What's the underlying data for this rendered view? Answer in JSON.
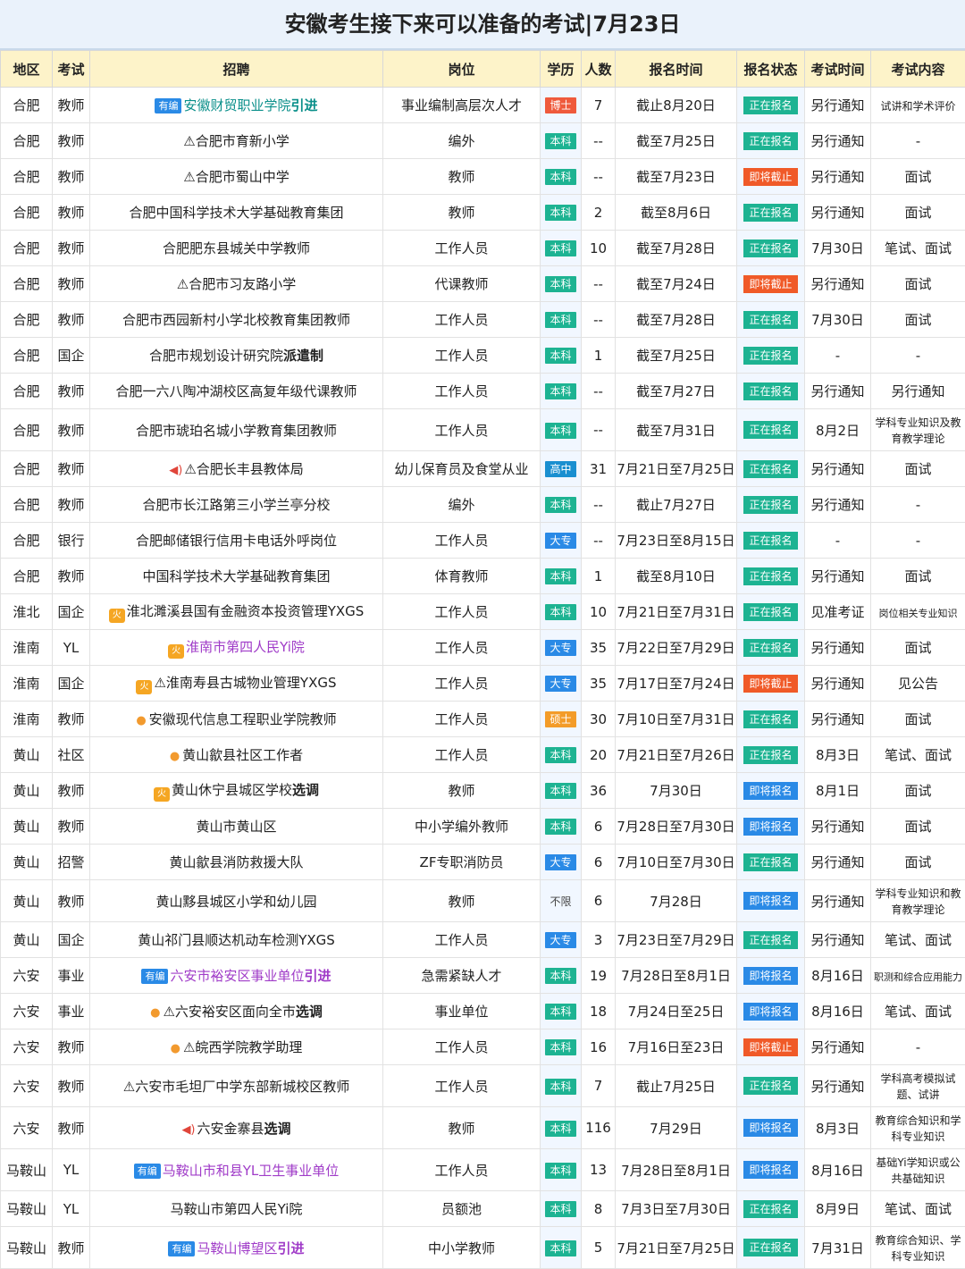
{
  "title": "安徽考生接下来可以准备的考试|7月23日",
  "headers": [
    "地区",
    "考试",
    "招聘",
    "岗位",
    "学历",
    "人数",
    "报名时间",
    "报名状态",
    "考试时间",
    "考试内容"
  ],
  "rows": [
    {
      "region": "合肥",
      "type": "教师",
      "pre": "tag",
      "tag": "有编",
      "name": "安徽财贸职业学院",
      "bold": "引进",
      "color": "teal",
      "post": "事业编制高层次人才",
      "edu": "博士",
      "eclass": "b-bs",
      "num": "7",
      "reg": "截止8月20日",
      "status": "正在报名",
      "sclass": "s-open",
      "exam": "另行通知",
      "content": "试讲和学术评价",
      "cclass": "sm"
    },
    {
      "region": "合肥",
      "type": "教师",
      "name": "⚠合肥市育新小学",
      "post": "编外",
      "edu": "本科",
      "eclass": "b-bk",
      "num": "--",
      "reg": "截至7月25日",
      "status": "正在报名",
      "sclass": "s-open",
      "exam": "另行通知",
      "content": "-"
    },
    {
      "region": "合肥",
      "type": "教师",
      "name": "⚠合肥市蜀山中学",
      "post": "教师",
      "edu": "本科",
      "eclass": "b-bk",
      "num": "--",
      "reg": "截至7月23日",
      "status": "即将截止",
      "sclass": "s-close",
      "exam": "另行通知",
      "content": "面试"
    },
    {
      "region": "合肥",
      "type": "教师",
      "name": "合肥中国科学技术大学基础教育集团",
      "post": "教师",
      "edu": "本科",
      "eclass": "b-bk",
      "num": "2",
      "reg": "截至8月6日",
      "status": "正在报名",
      "sclass": "s-open",
      "exam": "另行通知",
      "content": "面试"
    },
    {
      "region": "合肥",
      "type": "教师",
      "name": "合肥肥东县城关中学教师",
      "post": "工作人员",
      "edu": "本科",
      "eclass": "b-bk",
      "num": "10",
      "reg": "截至7月28日",
      "status": "正在报名",
      "sclass": "s-open",
      "exam": "7月30日",
      "content": "笔试、面试"
    },
    {
      "region": "合肥",
      "type": "教师",
      "name": "⚠合肥市习友路小学",
      "post": "代课教师",
      "edu": "本科",
      "eclass": "b-bk",
      "num": "--",
      "reg": "截至7月24日",
      "status": "即将截止",
      "sclass": "s-close",
      "exam": "另行通知",
      "content": "面试"
    },
    {
      "region": "合肥",
      "type": "教师",
      "name": "合肥市西园新村小学北校教育集团教师",
      "post": "工作人员",
      "edu": "本科",
      "eclass": "b-bk",
      "num": "--",
      "reg": "截至7月28日",
      "status": "正在报名",
      "sclass": "s-open",
      "exam": "7月30日",
      "content": "面试"
    },
    {
      "region": "合肥",
      "type": "国企",
      "name": "合肥市规划设计研究院",
      "bold": "派遣制",
      "post": "工作人员",
      "edu": "本科",
      "eclass": "b-bk",
      "num": "1",
      "reg": "截至7月25日",
      "status": "正在报名",
      "sclass": "s-open",
      "exam": "-",
      "content": "-"
    },
    {
      "region": "合肥",
      "type": "教师",
      "name": "合肥一六八陶冲湖校区高复年级代课教师",
      "post": "工作人员",
      "edu": "本科",
      "eclass": "b-bk",
      "num": "--",
      "reg": "截至7月27日",
      "status": "正在报名",
      "sclass": "s-open",
      "exam": "另行通知",
      "content": "另行通知"
    },
    {
      "region": "合肥",
      "type": "教师",
      "name": "合肥市琥珀名城小学教育集团教师",
      "post": "工作人员",
      "edu": "本科",
      "eclass": "b-bk",
      "num": "--",
      "reg": "截至7月31日",
      "status": "正在报名",
      "sclass": "s-open",
      "exam": "8月2日",
      "content": "学科专业知识及教育教学理论",
      "cclass": "sm",
      "tall": true
    },
    {
      "region": "合肥",
      "type": "教师",
      "pre": "mega",
      "name": "⚠合肥长丰县教体局",
      "post": "幼儿保育员及食堂从业",
      "edu": "高中",
      "eclass": "b-gz",
      "num": "31",
      "reg": "7月21日至7月25日",
      "status": "正在报名",
      "sclass": "s-open",
      "exam": "另行通知",
      "content": "面试"
    },
    {
      "region": "合肥",
      "type": "教师",
      "name": "合肥市长江路第三小学兰亭分校",
      "post": "编外",
      "edu": "本科",
      "eclass": "b-bk",
      "num": "--",
      "reg": "截止7月27日",
      "status": "正在报名",
      "sclass": "s-open",
      "exam": "另行通知",
      "content": "-"
    },
    {
      "region": "合肥",
      "type": "银行",
      "name": "合肥邮储银行信用卡电话外呼岗位",
      "post": "工作人员",
      "edu": "大专",
      "eclass": "b-dz",
      "num": "--",
      "reg": "7月23日至8月15日",
      "status": "正在报名",
      "sclass": "s-open",
      "exam": "-",
      "content": "-"
    },
    {
      "region": "合肥",
      "type": "教师",
      "name": "中国科学技术大学基础教育集团",
      "post": "体育教师",
      "edu": "本科",
      "eclass": "b-bk",
      "num": "1",
      "reg": "截至8月10日",
      "status": "正在报名",
      "sclass": "s-open",
      "exam": "另行通知",
      "content": "面试"
    },
    {
      "region": "淮北",
      "type": "国企",
      "pre": "fire",
      "name": "淮北濉溪县国有金融资本投资管理YXGS",
      "post": "工作人员",
      "edu": "本科",
      "eclass": "b-bk",
      "num": "10",
      "reg": "7月21日至7月31日",
      "status": "正在报名",
      "sclass": "s-open",
      "exam": "见准考证",
      "content": "岗位相关专业知识",
      "cclass": "xs"
    },
    {
      "region": "淮南",
      "type": "YL",
      "pre": "fire",
      "name": "淮南市第四人民Yi院",
      "color": "purple",
      "post": "工作人员",
      "edu": "大专",
      "eclass": "b-dz",
      "num": "35",
      "reg": "7月22日至7月29日",
      "status": "正在报名",
      "sclass": "s-open",
      "exam": "另行通知",
      "content": "面试"
    },
    {
      "region": "淮南",
      "type": "国企",
      "pre": "fire",
      "name": "⚠淮南寿县古城物业管理YXGS",
      "post": "工作人员",
      "edu": "大专",
      "eclass": "b-dz",
      "num": "35",
      "reg": "7月17日至7月24日",
      "status": "即将截止",
      "sclass": "s-close",
      "exam": "另行通知",
      "content": "见公告"
    },
    {
      "region": "淮南",
      "type": "教师",
      "pre": "thumb",
      "name": "安徽现代信息工程职业学院教师",
      "post": "工作人员",
      "edu": "硕士",
      "eclass": "b-ss",
      "num": "30",
      "reg": "7月10日至7月31日",
      "status": "正在报名",
      "sclass": "s-open",
      "exam": "另行通知",
      "content": "面试"
    },
    {
      "region": "黄山",
      "type": "社区",
      "pre": "thumb",
      "name": "黄山歙县社区工作者",
      "post": "工作人员",
      "edu": "本科",
      "eclass": "b-bk",
      "num": "20",
      "reg": "7月21日至7月26日",
      "status": "正在报名",
      "sclass": "s-open",
      "exam": "8月3日",
      "content": "笔试、面试"
    },
    {
      "region": "黄山",
      "type": "教师",
      "pre": "fire",
      "name": "黄山休宁县城区学校",
      "bold": "选调",
      "post": "教师",
      "edu": "本科",
      "eclass": "b-bk",
      "num": "36",
      "reg": "7月30日",
      "status": "即将报名",
      "sclass": "s-soon",
      "exam": "8月1日",
      "content": "面试"
    },
    {
      "region": "黄山",
      "type": "教师",
      "name": "黄山市黄山区",
      "post": "中小学编外教师",
      "edu": "本科",
      "eclass": "b-bk",
      "num": "6",
      "reg": "7月28日至7月30日",
      "status": "即将报名",
      "sclass": "s-soon",
      "exam": "另行通知",
      "content": "面试"
    },
    {
      "region": "黄山",
      "type": "招警",
      "name": "黄山歙县消防救援大队",
      "post": "ZF专职消防员",
      "edu": "大专",
      "eclass": "b-dz",
      "num": "6",
      "reg": "7月10日至7月30日",
      "status": "正在报名",
      "sclass": "s-open",
      "exam": "另行通知",
      "content": "面试"
    },
    {
      "region": "黄山",
      "type": "教师",
      "name": "黄山黟县城区小学和幼儿园",
      "post": "教师",
      "edu": "不限",
      "eclass": "b-bx",
      "num": "6",
      "reg": "7月28日",
      "status": "即将报名",
      "sclass": "s-soon",
      "exam": "另行通知",
      "content": "学科专业知识和教育教学理论",
      "cclass": "sm",
      "tall": true
    },
    {
      "region": "黄山",
      "type": "国企",
      "name": "黄山祁门县顺达机动车检测YXGS",
      "post": "工作人员",
      "edu": "大专",
      "eclass": "b-dz",
      "num": "3",
      "reg": "7月23日至7月29日",
      "status": "正在报名",
      "sclass": "s-open",
      "exam": "另行通知",
      "content": "笔试、面试"
    },
    {
      "region": "六安",
      "type": "事业",
      "pre": "tag",
      "tag": "有编",
      "name": "六安市裕安区事业单位",
      "bold": "引进",
      "color": "purple",
      "post": "急需紧缺人才",
      "edu": "本科",
      "eclass": "b-bk",
      "num": "19",
      "reg": "7月28日至8月1日",
      "status": "即将报名",
      "sclass": "s-soon",
      "exam": "8月16日",
      "content": "职测和综合应用能力",
      "cclass": "xs"
    },
    {
      "region": "六安",
      "type": "事业",
      "pre": "thumb",
      "name": "⚠六安裕安区面向全市",
      "bold": "选调",
      "post": "事业单位",
      "edu": "本科",
      "eclass": "b-bk",
      "num": "18",
      "reg": "7月24日至25日",
      "status": "即将报名",
      "sclass": "s-soon",
      "exam": "8月16日",
      "content": "笔试、面试"
    },
    {
      "region": "六安",
      "type": "教师",
      "pre": "thumb",
      "name": "⚠皖西学院教学助理",
      "post": "工作人员",
      "edu": "本科",
      "eclass": "b-bk",
      "num": "16",
      "reg": "7月16日至23日",
      "status": "即将截止",
      "sclass": "s-close",
      "exam": "另行通知",
      "content": "-"
    },
    {
      "region": "六安",
      "type": "教师",
      "name": "⚠六安市毛坦厂中学东部新城校区教师",
      "post": "工作人员",
      "edu": "本科",
      "eclass": "b-bk",
      "num": "7",
      "reg": "截止7月25日",
      "status": "正在报名",
      "sclass": "s-open",
      "exam": "另行通知",
      "content": "学科高考模拟试题、试讲",
      "cclass": "sm",
      "tall": true
    },
    {
      "region": "六安",
      "type": "教师",
      "pre": "mega",
      "name": "六安金寨县",
      "bold": "选调",
      "post": "教师",
      "edu": "本科",
      "eclass": "b-bk",
      "num": "116",
      "reg": "7月29日",
      "status": "即将报名",
      "sclass": "s-soon",
      "exam": "8月3日",
      "content": "教育综合知识和学科专业知识",
      "cclass": "sm",
      "tall": true
    },
    {
      "region": "马鞍山",
      "type": "YL",
      "pre": "tag",
      "tag": "有编",
      "name": "马鞍山市和县YL卫生事业单位",
      "color": "purple",
      "post": "工作人员",
      "edu": "本科",
      "eclass": "b-bk",
      "num": "13",
      "reg": "7月28日至8月1日",
      "status": "即将报名",
      "sclass": "s-soon",
      "exam": "8月16日",
      "content": "基础Yi学知识或公共基础知识",
      "cclass": "sm",
      "tall": true
    },
    {
      "region": "马鞍山",
      "type": "YL",
      "name": "马鞍山市第四人民Yi院",
      "post": "员额池",
      "edu": "本科",
      "eclass": "b-bk",
      "num": "8",
      "reg": "7月3日至7月30日",
      "status": "正在报名",
      "sclass": "s-open",
      "exam": "8月9日",
      "content": "笔试、面试"
    },
    {
      "region": "马鞍山",
      "type": "教师",
      "pre": "tag",
      "tag": "有编",
      "name": "马鞍山博望区",
      "bold": "引进",
      "color": "purple",
      "post": "中小学教师",
      "edu": "本科",
      "eclass": "b-bk",
      "num": "5",
      "reg": "7月21日至7月25日",
      "status": "正在报名",
      "sclass": "s-open",
      "exam": "7月31日",
      "content": "教育综合知识、学科专业知识",
      "cclass": "sm",
      "tall": true
    }
  ]
}
